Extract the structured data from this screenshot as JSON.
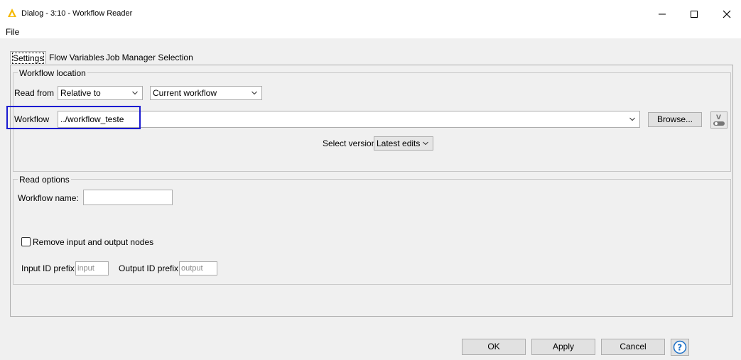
{
  "window": {
    "title": "Dialog - 3:10 - Workflow Reader",
    "controls": [
      "minimize-icon",
      "maximize-icon",
      "close-icon"
    ]
  },
  "menu": {
    "file": "File"
  },
  "tabs": [
    {
      "label": "Settings",
      "active": true
    },
    {
      "label": "Flow Variables",
      "active": false
    },
    {
      "label": "Job Manager Selection",
      "active": false
    }
  ],
  "workflow_location": {
    "legend": "Workflow location",
    "read_from_label": "Read from",
    "read_from_value": "Relative to",
    "relative_value": "Current workflow",
    "workflow_label": "Workflow",
    "workflow_value": "../workflow_teste",
    "browse_label": "Browse...",
    "select_version_label": "Select version",
    "select_version_value": "Latest edits"
  },
  "read_options": {
    "legend": "Read options",
    "workflow_name_label": "Workflow name:",
    "workflow_name_value": "",
    "remove_nodes_label": "Remove input and output nodes",
    "remove_nodes_checked": false,
    "input_prefix_label": "Input ID prefix",
    "input_prefix_placeholder": "input",
    "output_prefix_label": "Output ID prefix",
    "output_prefix_placeholder": "output"
  },
  "buttons": {
    "ok": "OK",
    "apply": "Apply",
    "cancel": "Cancel"
  },
  "colors": {
    "highlight": "#1a1ad1",
    "help_icon": "#1a6fc7",
    "app_icon": "#f5b800"
  }
}
